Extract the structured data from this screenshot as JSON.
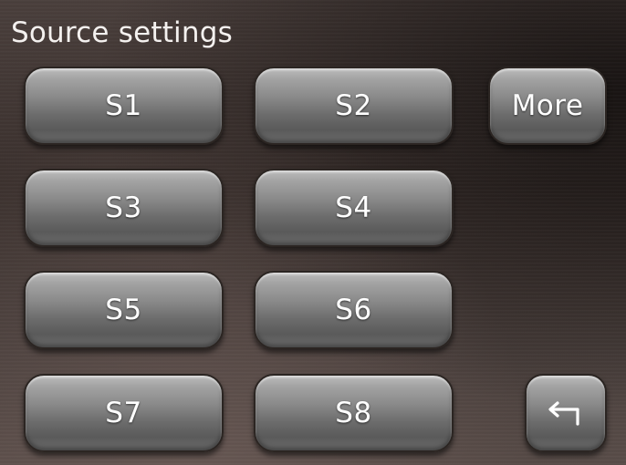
{
  "header": {
    "title": "Source settings"
  },
  "sources": [
    {
      "label": "S1"
    },
    {
      "label": "S2"
    },
    {
      "label": "S3"
    },
    {
      "label": "S4"
    },
    {
      "label": "S5"
    },
    {
      "label": "S6"
    },
    {
      "label": "S7"
    },
    {
      "label": "S8"
    }
  ],
  "more_button": {
    "label": "More"
  },
  "back_button": {
    "icon": "return-arrow-icon"
  },
  "colors": {
    "button_top": "#bcbcbc",
    "button_bottom": "#5a5a5a",
    "text": "#ffffff",
    "background": "#3b312e"
  }
}
